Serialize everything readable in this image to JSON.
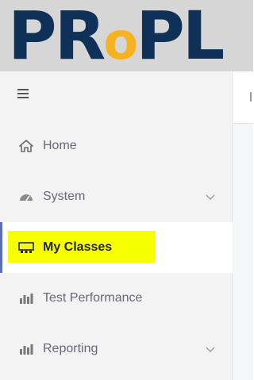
{
  "logo": {
    "part1": "PR",
    "part2": "o",
    "part3": "PL"
  },
  "sidebar": {
    "items": [
      {
        "label": "Home"
      },
      {
        "label": "System"
      },
      {
        "label": "My Classes"
      },
      {
        "label": "Test Performance"
      },
      {
        "label": "Reporting"
      }
    ]
  },
  "colors": {
    "logo_dark": "#0f3057",
    "logo_accent": "#f6b321",
    "highlight": "#f8ff00",
    "active_accent": "#5b6fb8"
  }
}
